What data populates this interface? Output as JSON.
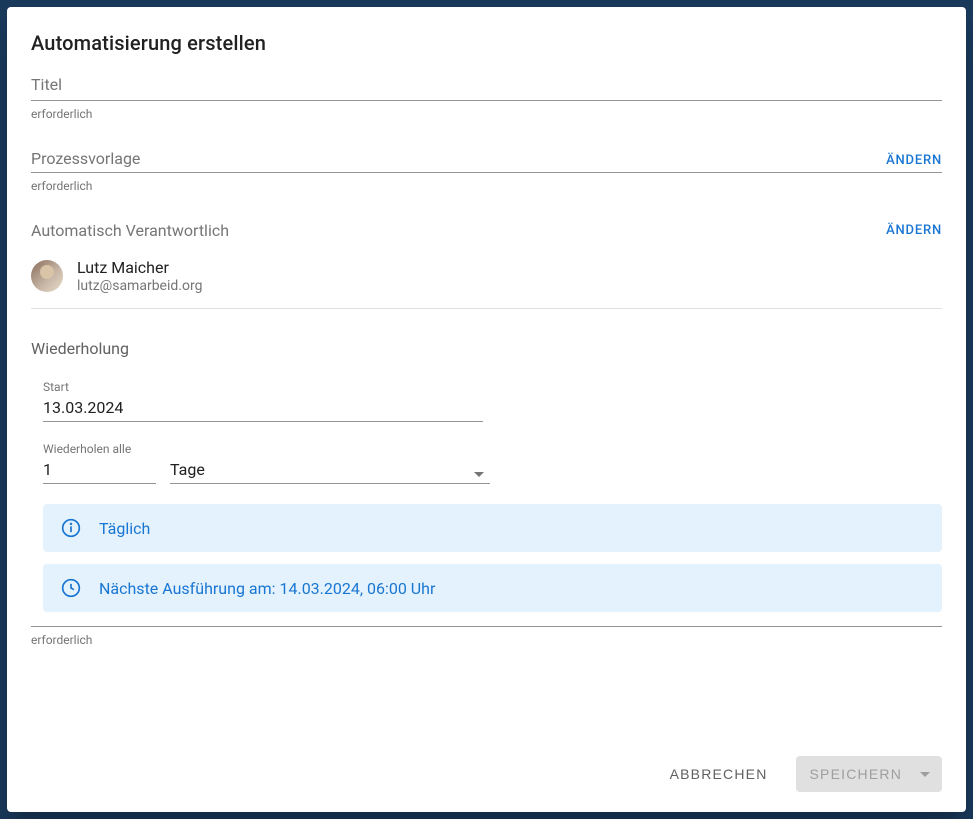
{
  "dialog": {
    "title": "Automatisierung erstellen",
    "fields": {
      "titel": {
        "label": "Titel",
        "helper": "erforderlich"
      },
      "prozessvorlage": {
        "label": "Prozessvorlage",
        "change": "ÄNDERN",
        "helper": "erforderlich"
      },
      "verantwortlich": {
        "label": "Automatisch Verantwortlich",
        "change": "ÄNDERN",
        "person": {
          "name": "Lutz Maicher",
          "email": "lutz@samarbeid.org"
        }
      },
      "wiederholung": {
        "label": "Wiederholung",
        "start": {
          "label": "Start",
          "value": "13.03.2024"
        },
        "interval": {
          "label": "Wiederholen alle",
          "value": "1",
          "unit": "Tage"
        },
        "info_frequency": "Täglich",
        "info_next": "Nächste Ausführung am: 14.03.2024, 06:00 Uhr",
        "helper": "erforderlich"
      }
    },
    "actions": {
      "cancel": "ABBRECHEN",
      "save": "SPEICHERN"
    }
  }
}
